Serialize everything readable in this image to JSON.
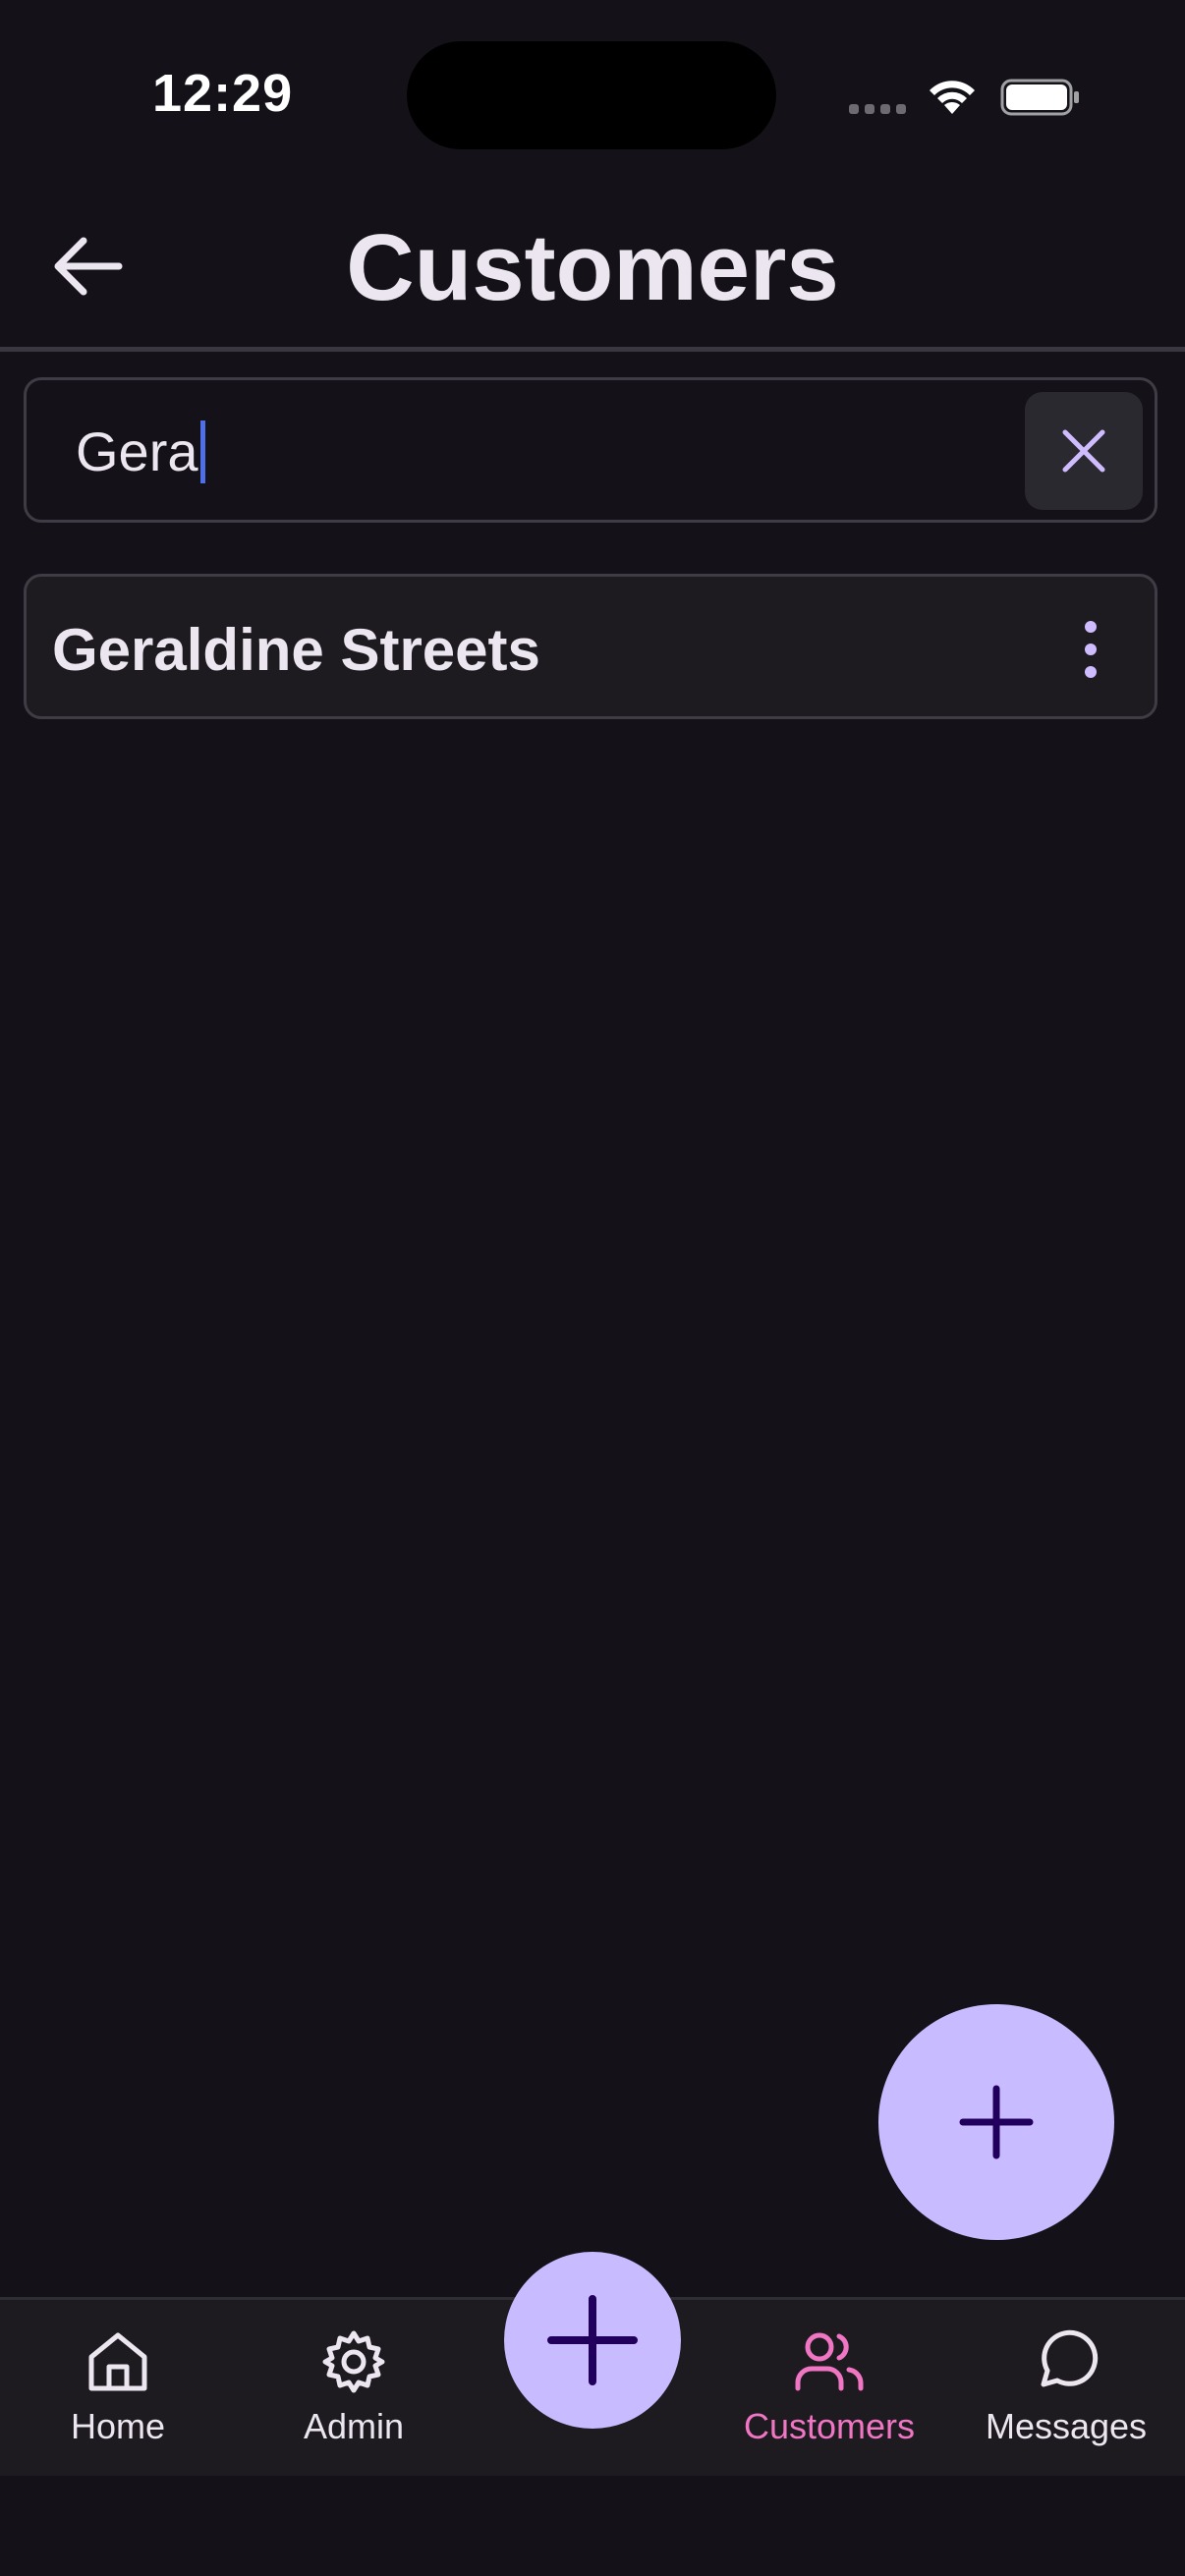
{
  "status_bar": {
    "time": "12:29"
  },
  "header": {
    "title": "Customers",
    "back_icon": "arrow-left-icon"
  },
  "search": {
    "value": "Gera",
    "clear_icon": "close-icon"
  },
  "results": [
    {
      "name": "Geraldine Streets",
      "menu_icon": "more-vertical-icon"
    }
  ],
  "fab": {
    "icon": "plus-icon"
  },
  "bottom_nav": {
    "items": [
      {
        "label": "Home",
        "icon": "home-icon",
        "active": false
      },
      {
        "label": "Admin",
        "icon": "gear-icon",
        "active": false
      },
      {
        "label": "Customers",
        "icon": "users-icon",
        "active": true
      },
      {
        "label": "Messages",
        "icon": "message-circle-icon",
        "active": false
      }
    ],
    "center_icon": "plus-icon"
  },
  "colors": {
    "background": "#141218",
    "accent": "#C9BBFF",
    "active_nav": "#F076C4",
    "caret": "#4F6FE8",
    "on_accent": "#21005D"
  }
}
